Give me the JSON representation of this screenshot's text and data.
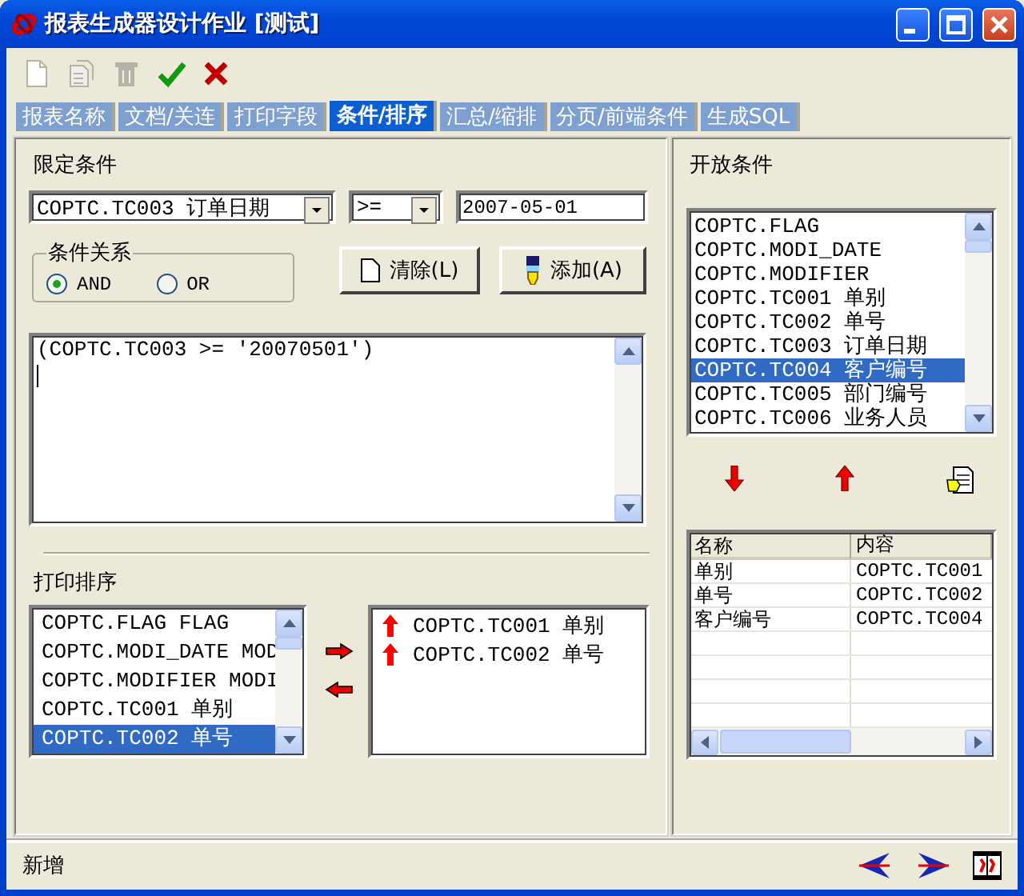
{
  "window": {
    "title": "报表生成器设计作业 [测试]"
  },
  "toolbar": [
    {
      "kind": "new",
      "disabled": true
    },
    {
      "kind": "copy",
      "disabled": true
    },
    {
      "kind": "delete",
      "disabled": true
    },
    {
      "kind": "confirm",
      "disabled": false
    },
    {
      "kind": "cancel",
      "disabled": false
    }
  ],
  "tabs": [
    {
      "label": "报表名称",
      "selected": false
    },
    {
      "label": "文档/关连",
      "selected": false
    },
    {
      "label": "打印字段",
      "selected": false
    },
    {
      "label": "条件/排序",
      "selected": true
    },
    {
      "label": "汇总/缩排",
      "selected": false
    },
    {
      "label": "分页/前端条件",
      "selected": false
    },
    {
      "label": "生成SQL",
      "selected": false
    }
  ],
  "condition": {
    "title": "限定条件",
    "field": "COPTC.TC003 订单日期",
    "operator": ">=",
    "value": "2007-05-01",
    "relation": {
      "title": "条件关系",
      "options": [
        {
          "label": "AND",
          "selected": true
        },
        {
          "label": "OR",
          "selected": false
        }
      ]
    },
    "buttons": [
      {
        "kind": "clear",
        "label": "清除(L)"
      },
      {
        "kind": "add",
        "label": "添加(A)"
      }
    ],
    "expression": "(COPTC.TC003 >= '20070501')"
  },
  "sort": {
    "title": "打印排序",
    "available": [
      {
        "label": "COPTC.FLAG FLAG",
        "selected": false
      },
      {
        "label": "COPTC.MODI_DATE MOD",
        "selected": false
      },
      {
        "label": "COPTC.MODIFIER MODI",
        "selected": false
      },
      {
        "label": "COPTC.TC001 单别",
        "selected": false
      },
      {
        "label": "COPTC.TC002 单号",
        "selected": true
      }
    ],
    "chosen": [
      {
        "label": "COPTC.TC001 单别",
        "ascending": true
      },
      {
        "label": "COPTC.TC002 单号",
        "ascending": true
      }
    ]
  },
  "open_conditions": {
    "title": "开放条件",
    "fields": [
      {
        "label": "COPTC.FLAG",
        "selected": false
      },
      {
        "label": "COPTC.MODI_DATE",
        "selected": false
      },
      {
        "label": "COPTC.MODIFIER",
        "selected": false
      },
      {
        "label": "COPTC.TC001 单别",
        "selected": false
      },
      {
        "label": "COPTC.TC002 单号",
        "selected": false
      },
      {
        "label": "COPTC.TC003 订单日期",
        "selected": false
      },
      {
        "label": "COPTC.TC004 客户编号",
        "selected": true
      },
      {
        "label": "COPTC.TC005 部门编号",
        "selected": false
      },
      {
        "label": "COPTC.TC006 业务人员",
        "selected": false
      }
    ],
    "columns": [
      "名称",
      "内容"
    ],
    "rows": [
      [
        "单别",
        "COPTC.TC001"
      ],
      [
        "单号",
        "COPTC.TC002"
      ],
      [
        "客户编号",
        "COPTC.TC004"
      ]
    ]
  },
  "status_bar": {
    "text": "新增"
  }
}
